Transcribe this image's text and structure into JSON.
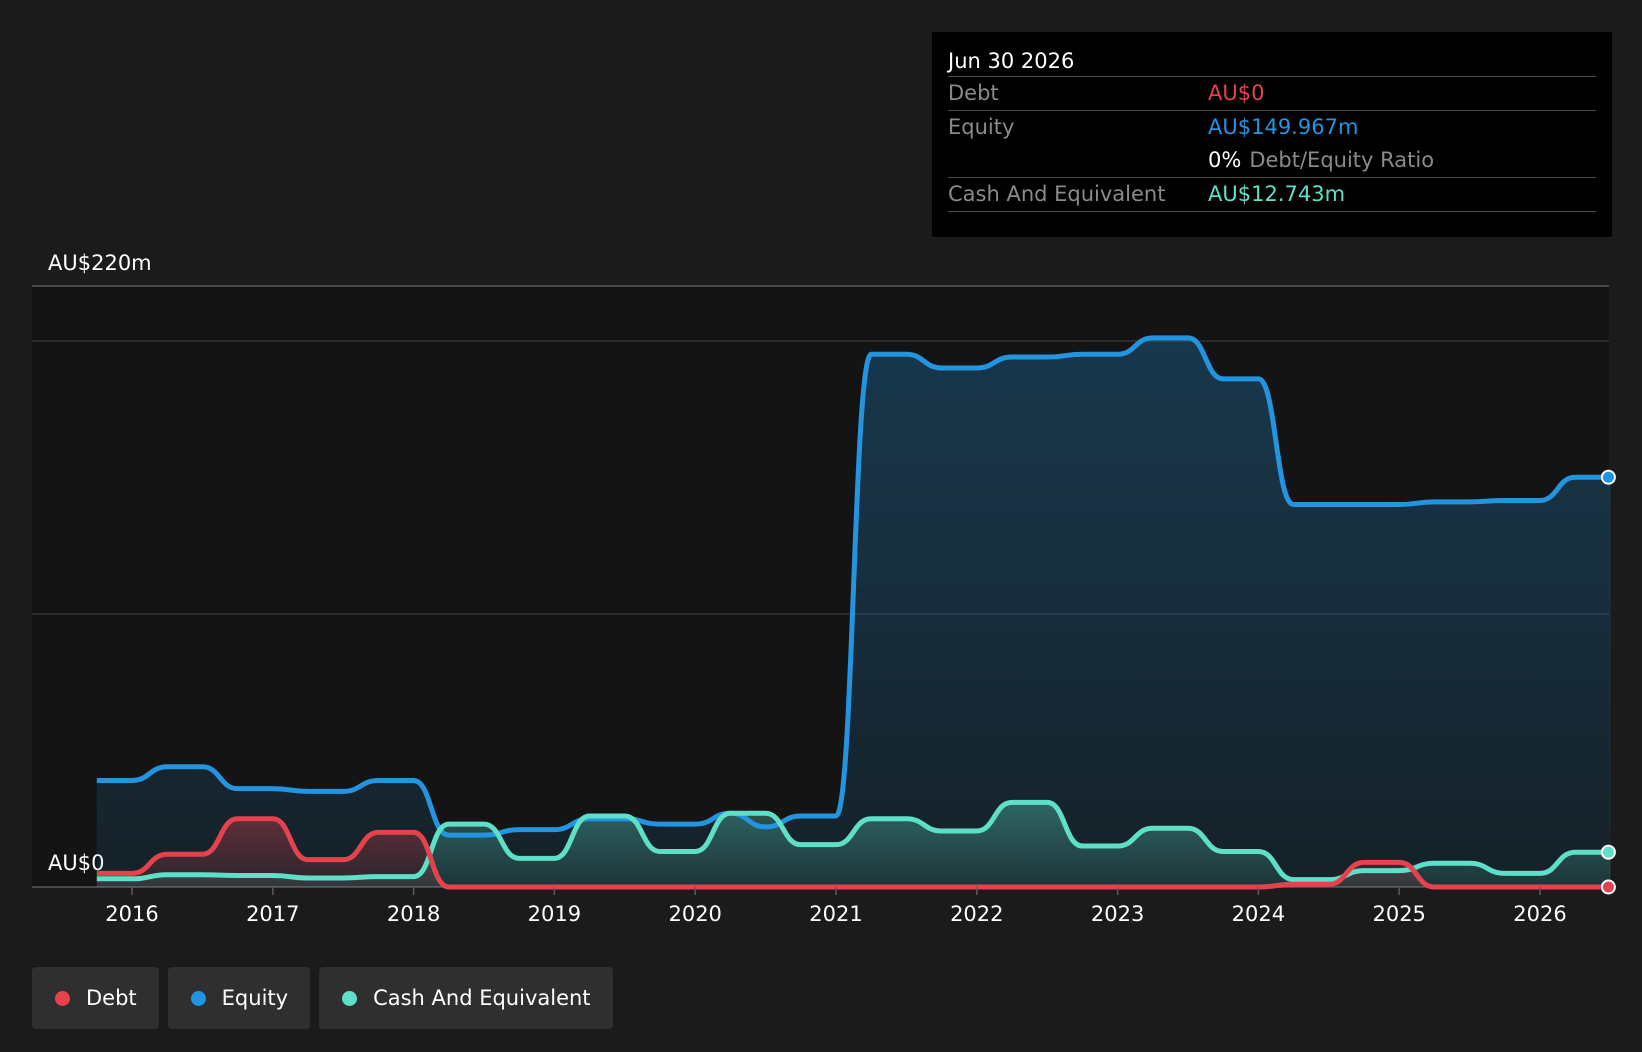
{
  "tooltip": {
    "date": "Jun 30 2026",
    "debt_label": "Debt",
    "debt_value": "AU$0",
    "equity_label": "Equity",
    "equity_value": "AU$149.967m",
    "ratio_value": "0%",
    "ratio_label": "Debt/Equity Ratio",
    "cash_label": "Cash And Equivalent",
    "cash_value": "AU$12.743m"
  },
  "legend": [
    {
      "label": "Debt",
      "color": "#e5424d"
    },
    {
      "label": "Equity",
      "color": "#2394df"
    },
    {
      "label": "Cash And Equivalent",
      "color": "#5ee0c8"
    }
  ],
  "chart_data": {
    "type": "area",
    "y_top_label": "AU$220m",
    "y_bottom_label": "AU$0",
    "ylim": [
      0,
      220
    ],
    "xlim": [
      2015.3,
      2026.5
    ],
    "x_ticks": [
      "2016",
      "2017",
      "2018",
      "2019",
      "2020",
      "2021",
      "2022",
      "2023",
      "2024",
      "2025",
      "2026"
    ],
    "grid": true,
    "colors": {
      "debt": "#e5424d",
      "equity": "#2394df",
      "cash": "#5ee0c8"
    },
    "series": [
      {
        "name": "Debt",
        "x": [
          2015.75,
          2016.0,
          2016.25,
          2016.5,
          2016.75,
          2017.0,
          2017.25,
          2017.5,
          2017.75,
          2018.0,
          2018.25,
          2018.5,
          2018.75,
          2019.0,
          2019.25,
          2019.5,
          2019.75,
          2020.0,
          2020.25,
          2020.5,
          2020.75,
          2021.0,
          2021.25,
          2021.5,
          2021.75,
          2022.0,
          2022.25,
          2022.5,
          2022.75,
          2023.0,
          2023.25,
          2023.5,
          2023.75,
          2024.0,
          2024.25,
          2024.5,
          2024.75,
          2025.0,
          2025.25,
          2025.5,
          2025.75,
          2026.0,
          2026.25,
          2026.5
        ],
        "values": [
          5,
          5,
          12,
          12,
          25,
          25,
          10,
          10,
          20,
          20,
          0,
          0,
          0,
          0,
          0,
          0,
          0,
          0,
          0,
          0,
          0,
          0,
          0,
          0,
          0,
          0,
          0,
          0,
          0,
          0,
          0,
          0,
          0,
          0,
          1,
          1,
          9,
          9,
          0,
          0,
          0,
          0,
          0,
          0
        ]
      },
      {
        "name": "Equity",
        "x": [
          2015.75,
          2016.0,
          2016.25,
          2016.5,
          2016.75,
          2017.0,
          2017.25,
          2017.5,
          2017.75,
          2018.0,
          2018.25,
          2018.5,
          2018.75,
          2019.0,
          2019.25,
          2019.5,
          2019.75,
          2020.0,
          2020.25,
          2020.5,
          2020.75,
          2021.0,
          2021.25,
          2021.5,
          2021.75,
          2022.0,
          2022.25,
          2022.5,
          2022.75,
          2023.0,
          2023.25,
          2023.5,
          2023.75,
          2024.0,
          2024.25,
          2024.5,
          2024.75,
          2025.0,
          2025.25,
          2025.5,
          2025.75,
          2026.0,
          2026.25,
          2026.5
        ],
        "values": [
          39,
          39,
          44,
          44,
          36,
          36,
          35,
          35,
          39,
          39,
          19,
          19,
          21,
          21,
          25,
          25,
          23,
          23,
          27,
          22,
          26,
          26,
          195,
          195,
          190,
          190,
          194,
          194,
          195,
          195,
          201,
          201,
          186,
          186,
          140,
          140,
          140,
          140,
          141,
          141,
          141.5,
          141.5,
          150,
          150
        ]
      },
      {
        "name": "Cash And Equivalent",
        "x": [
          2015.75,
          2016.0,
          2016.25,
          2016.5,
          2016.75,
          2017.0,
          2017.25,
          2017.5,
          2017.75,
          2018.0,
          2018.25,
          2018.5,
          2018.75,
          2019.0,
          2019.25,
          2019.5,
          2019.75,
          2020.0,
          2020.25,
          2020.5,
          2020.75,
          2021.0,
          2021.25,
          2021.5,
          2021.75,
          2022.0,
          2022.25,
          2022.5,
          2022.75,
          2023.0,
          2023.25,
          2023.5,
          2023.75,
          2024.0,
          2024.25,
          2024.5,
          2024.75,
          2025.0,
          2025.25,
          2025.5,
          2025.75,
          2026.0,
          2026.25,
          2026.5
        ],
        "values": [
          3,
          3,
          4.5,
          4.5,
          4.2,
          4.2,
          3.3,
          3.3,
          3.8,
          3.8,
          23,
          23,
          10.5,
          10.5,
          26,
          26,
          13,
          13,
          27,
          27,
          15.5,
          15.5,
          25,
          25,
          20.5,
          20.5,
          31,
          31,
          15,
          15,
          21.5,
          21.5,
          13,
          13,
          2.7,
          2.7,
          6,
          6,
          8.7,
          8.7,
          5,
          5,
          12.743,
          12.743
        ]
      }
    ]
  }
}
